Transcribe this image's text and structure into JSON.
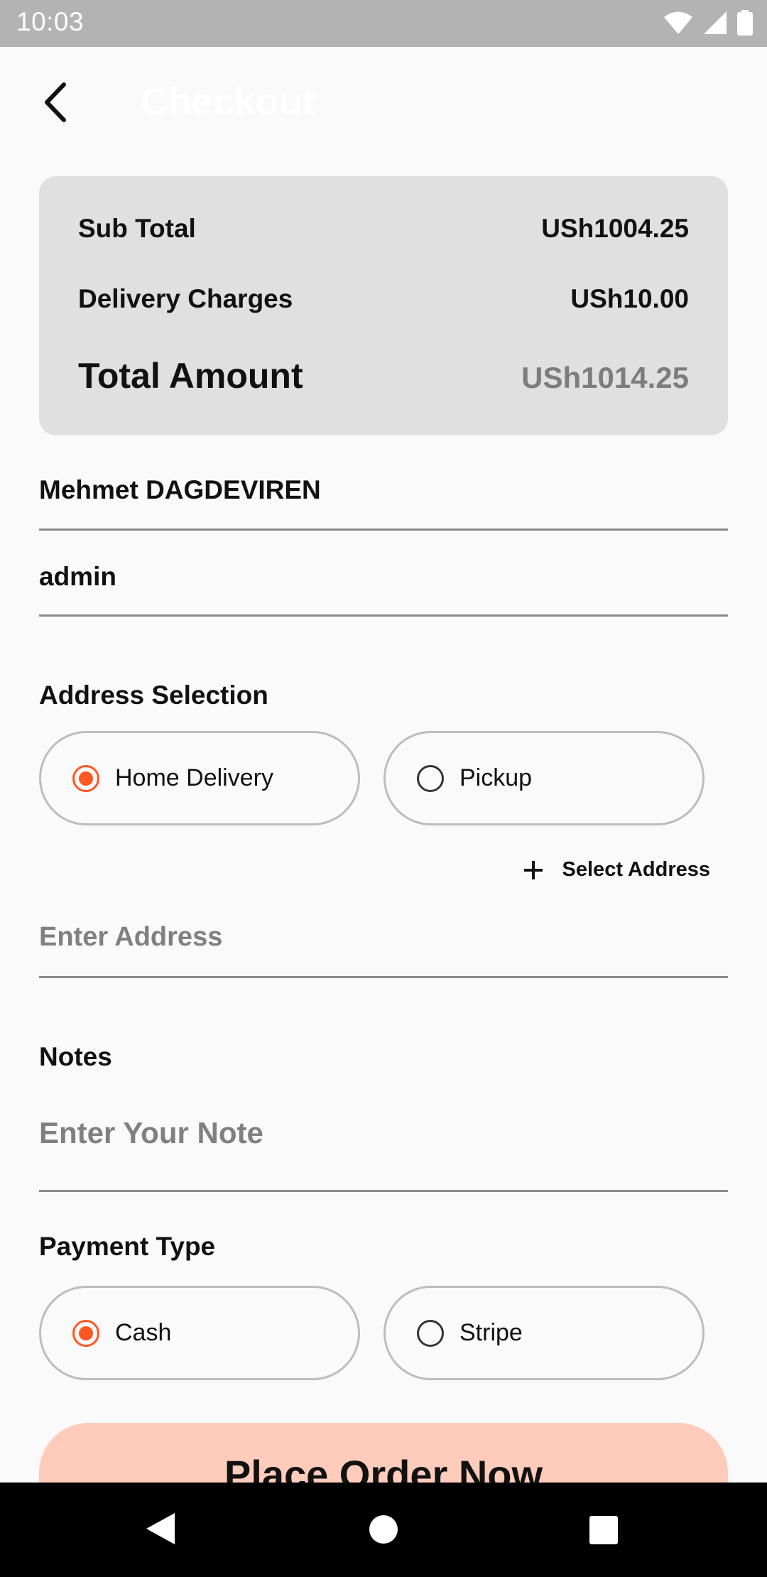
{
  "status_bar": {
    "time": "10:03",
    "icons": [
      "wifi-icon",
      "signal-icon",
      "battery-icon"
    ]
  },
  "header": {
    "back_icon": "chevron-left-icon",
    "title": "Checkout"
  },
  "summary": {
    "sub_total_label": "Sub Total",
    "sub_total_value": "USh1004.25",
    "delivery_label": "Delivery Charges",
    "delivery_value": "USh10.00",
    "total_label": "Total Amount",
    "total_value": "USh1014.25"
  },
  "customer": {
    "name_value": "Mehmet DAGDEVIREN",
    "phone_value": "admin"
  },
  "address": {
    "section_title": "Address Selection",
    "options": [
      {
        "label": "Home Delivery",
        "selected": true
      },
      {
        "label": "Pickup",
        "selected": false
      }
    ],
    "select_address_label": "Select Address",
    "address_placeholder": "Enter Address"
  },
  "notes": {
    "section_title": "Notes",
    "placeholder": "Enter Your Note"
  },
  "payment": {
    "section_title": "Payment Type",
    "options": [
      {
        "label": "Cash",
        "selected": true
      },
      {
        "label": "Stripe",
        "selected": false
      }
    ]
  },
  "place_order_label": "Place Order Now",
  "colors": {
    "accent": "#ff5722",
    "button_bg": "#ffcbbb",
    "card_bg": "#e0e0e0",
    "status_bar": "#b3b3b3"
  }
}
